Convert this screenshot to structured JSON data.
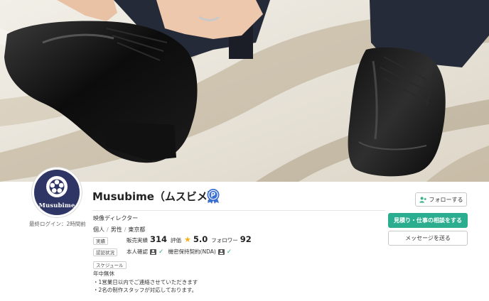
{
  "cover": {
    "image": "cover-photo-dress-shoes"
  },
  "profile": {
    "avatar_brand": "Musubime",
    "last_login": "最終ログイン：2時間前",
    "name": "Musubime（ムスビメ）",
    "badge_icon": "p-badge-icon",
    "job": "映像ディレクター",
    "attributes": [
      "個人",
      "男性",
      "東京都"
    ]
  },
  "record": {
    "tag": "実績",
    "sales_label": "販売実績",
    "sales_count": "314",
    "rating_label": "評価",
    "rating_value": "5.0",
    "followers_label": "フォロワー",
    "followers_count": "92"
  },
  "verification": {
    "tag": "認証状況",
    "identity_label": "本人確認",
    "nda_label": "機密保持契約(NDA)"
  },
  "schedule": {
    "tag": "スケジュール",
    "lines": [
      "年中無休",
      "・1営業日以内でご連絡させていただきます",
      "・2名の制作スタッフが対応しております。"
    ]
  },
  "actions": {
    "follow_label": "フォローする",
    "consult_label": "見積り・仕事の相談をする",
    "message_label": "メッセージを送る"
  },
  "colors": {
    "accent": "#2bae8f",
    "avatar_bg": "#2f3565",
    "star": "#f2b01e",
    "check": "#3cb08e",
    "badge": "#3b6fd4"
  }
}
